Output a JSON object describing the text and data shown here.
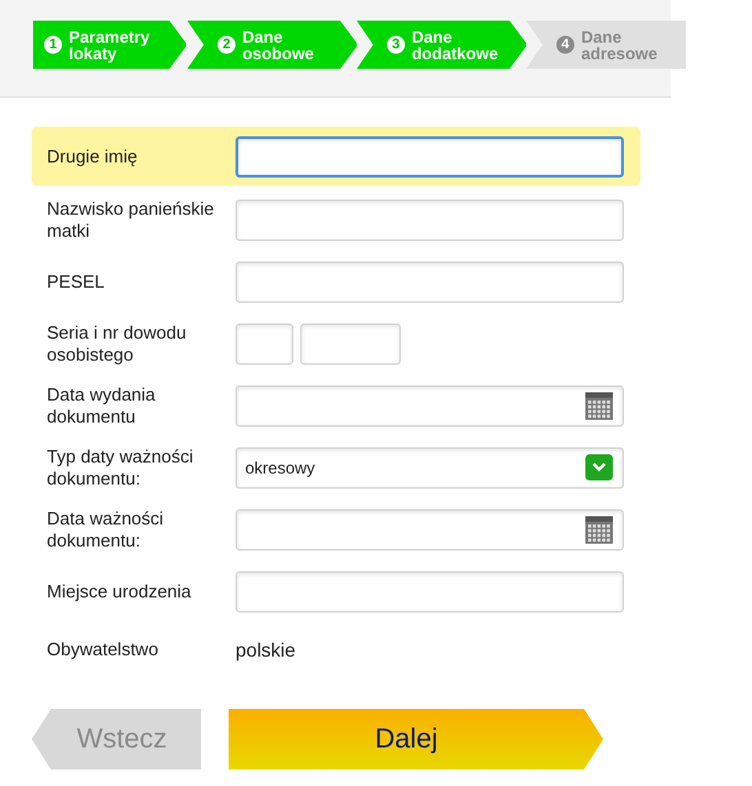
{
  "steps": [
    {
      "number": "1",
      "label": "Parametry lokaty",
      "enabled": true
    },
    {
      "number": "2",
      "label": "Dane osobowe",
      "enabled": true
    },
    {
      "number": "3",
      "label": "Dane dodatkowe",
      "enabled": true
    },
    {
      "number": "4",
      "label": "Dane adresowe",
      "enabled": false
    }
  ],
  "fields": [
    {
      "kind": "text",
      "label": "Drugie imię",
      "focused": true
    },
    {
      "kind": "text",
      "label": "Nazwisko panieńskie matki",
      "focused": false
    },
    {
      "kind": "text",
      "label": "PESEL",
      "focused": false
    },
    {
      "kind": "id",
      "label": "Seria i nr dowodu osobistego",
      "focused": false
    },
    {
      "kind": "date",
      "label": "Data wydania dokumentu",
      "focused": false
    },
    {
      "kind": "select",
      "label": "Typ daty ważności dokumentu:",
      "value": "okresowy",
      "focused": false
    },
    {
      "kind": "date",
      "label": "Data ważności dokumentu:",
      "focused": false
    },
    {
      "kind": "text",
      "label": "Miejsce urodzenia",
      "focused": false
    },
    {
      "kind": "static",
      "label": "Obywatelstwo",
      "value": "polskie",
      "focused": false
    }
  ],
  "buttons": {
    "back": {
      "label": "Wstecz",
      "disabled": true
    },
    "next": {
      "label": "Dalej",
      "disabled": false
    }
  }
}
